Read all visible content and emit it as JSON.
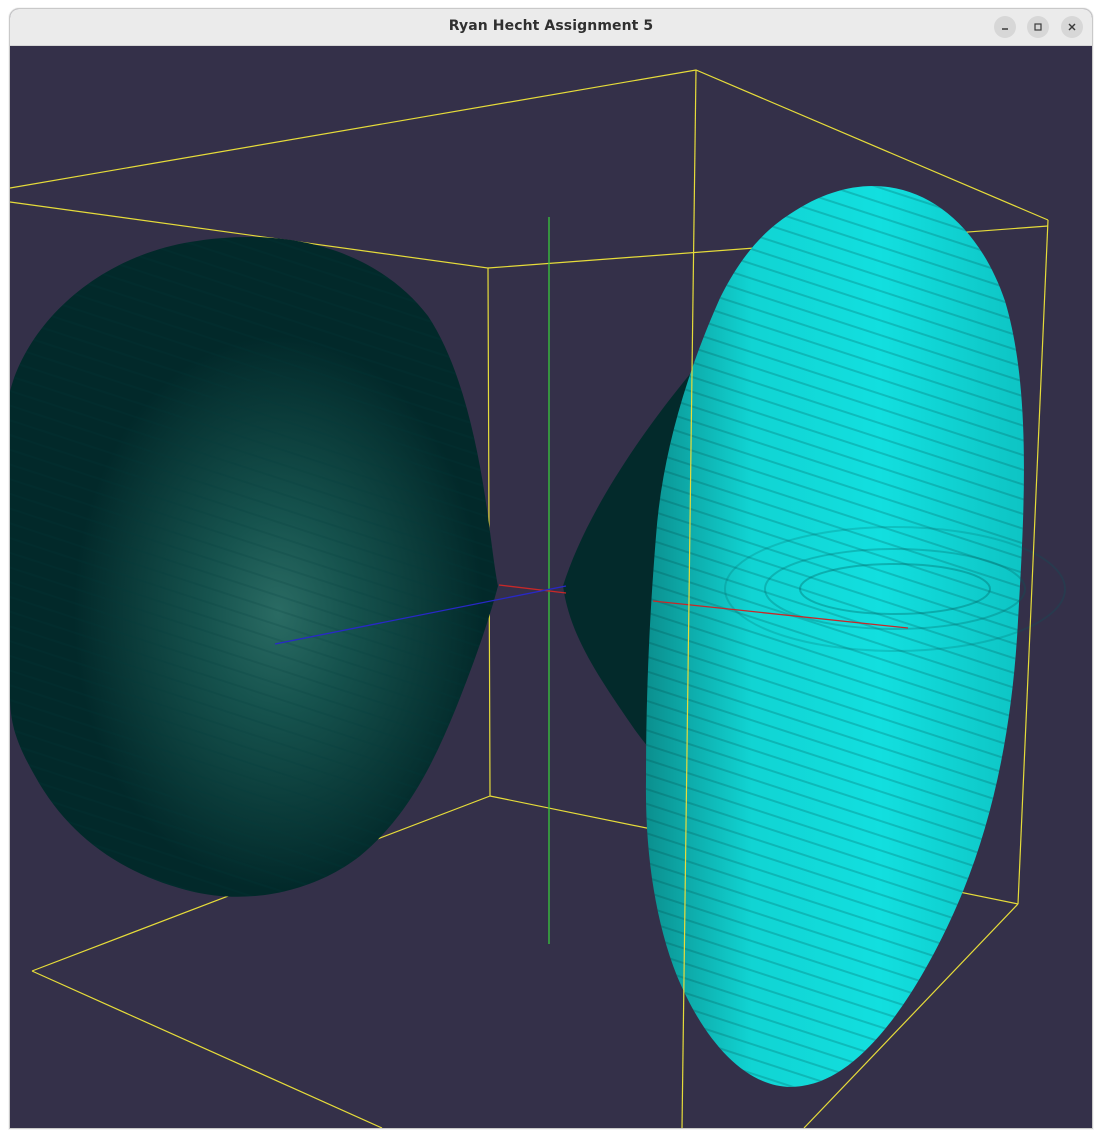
{
  "window": {
    "title": "Ryan Hecht Assignment 5",
    "controls": {
      "minimize": "minimize-icon",
      "maximize": "maximize-icon",
      "close": "close-icon"
    }
  },
  "scene": {
    "background_color": "#343049",
    "bounding_box_color": "#e6dc3a",
    "axis_colors": {
      "x": "#c82828",
      "y": "#37c83c",
      "z": "#2828c8"
    },
    "left_surface_color": "#02292a",
    "right_surface_color": "#11d8d8",
    "shadow_surface_color": "#032a2b"
  }
}
